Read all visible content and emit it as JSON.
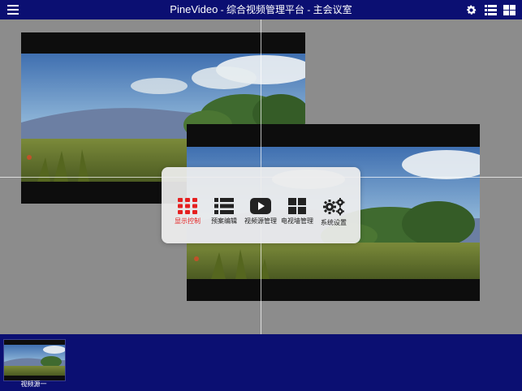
{
  "header": {
    "brand": "PineVideo",
    "subtitle": " - 综合视频管理平台 - 主会议室",
    "menu_icon": "hamburger-menu-icon",
    "right_icons": [
      "gear-icon",
      "list-icon",
      "grid-icon"
    ]
  },
  "menu": {
    "items": [
      {
        "label": "显示控制",
        "icon": "dot-grid-icon",
        "active": true
      },
      {
        "label": "预案编辑",
        "icon": "list-icon",
        "active": false
      },
      {
        "label": "视频源管理",
        "icon": "play-button-icon",
        "active": false
      },
      {
        "label": "电视墙管理",
        "icon": "four-square-grid-icon",
        "active": false
      },
      {
        "label": "系统设置",
        "icon": "gears-icon",
        "active": false
      }
    ]
  },
  "sources": [
    {
      "label": "视频源一"
    }
  ],
  "colors": {
    "header_bg": "#0b0f72",
    "stage_bg": "#8c8c8c",
    "active_red": "#e52020"
  }
}
